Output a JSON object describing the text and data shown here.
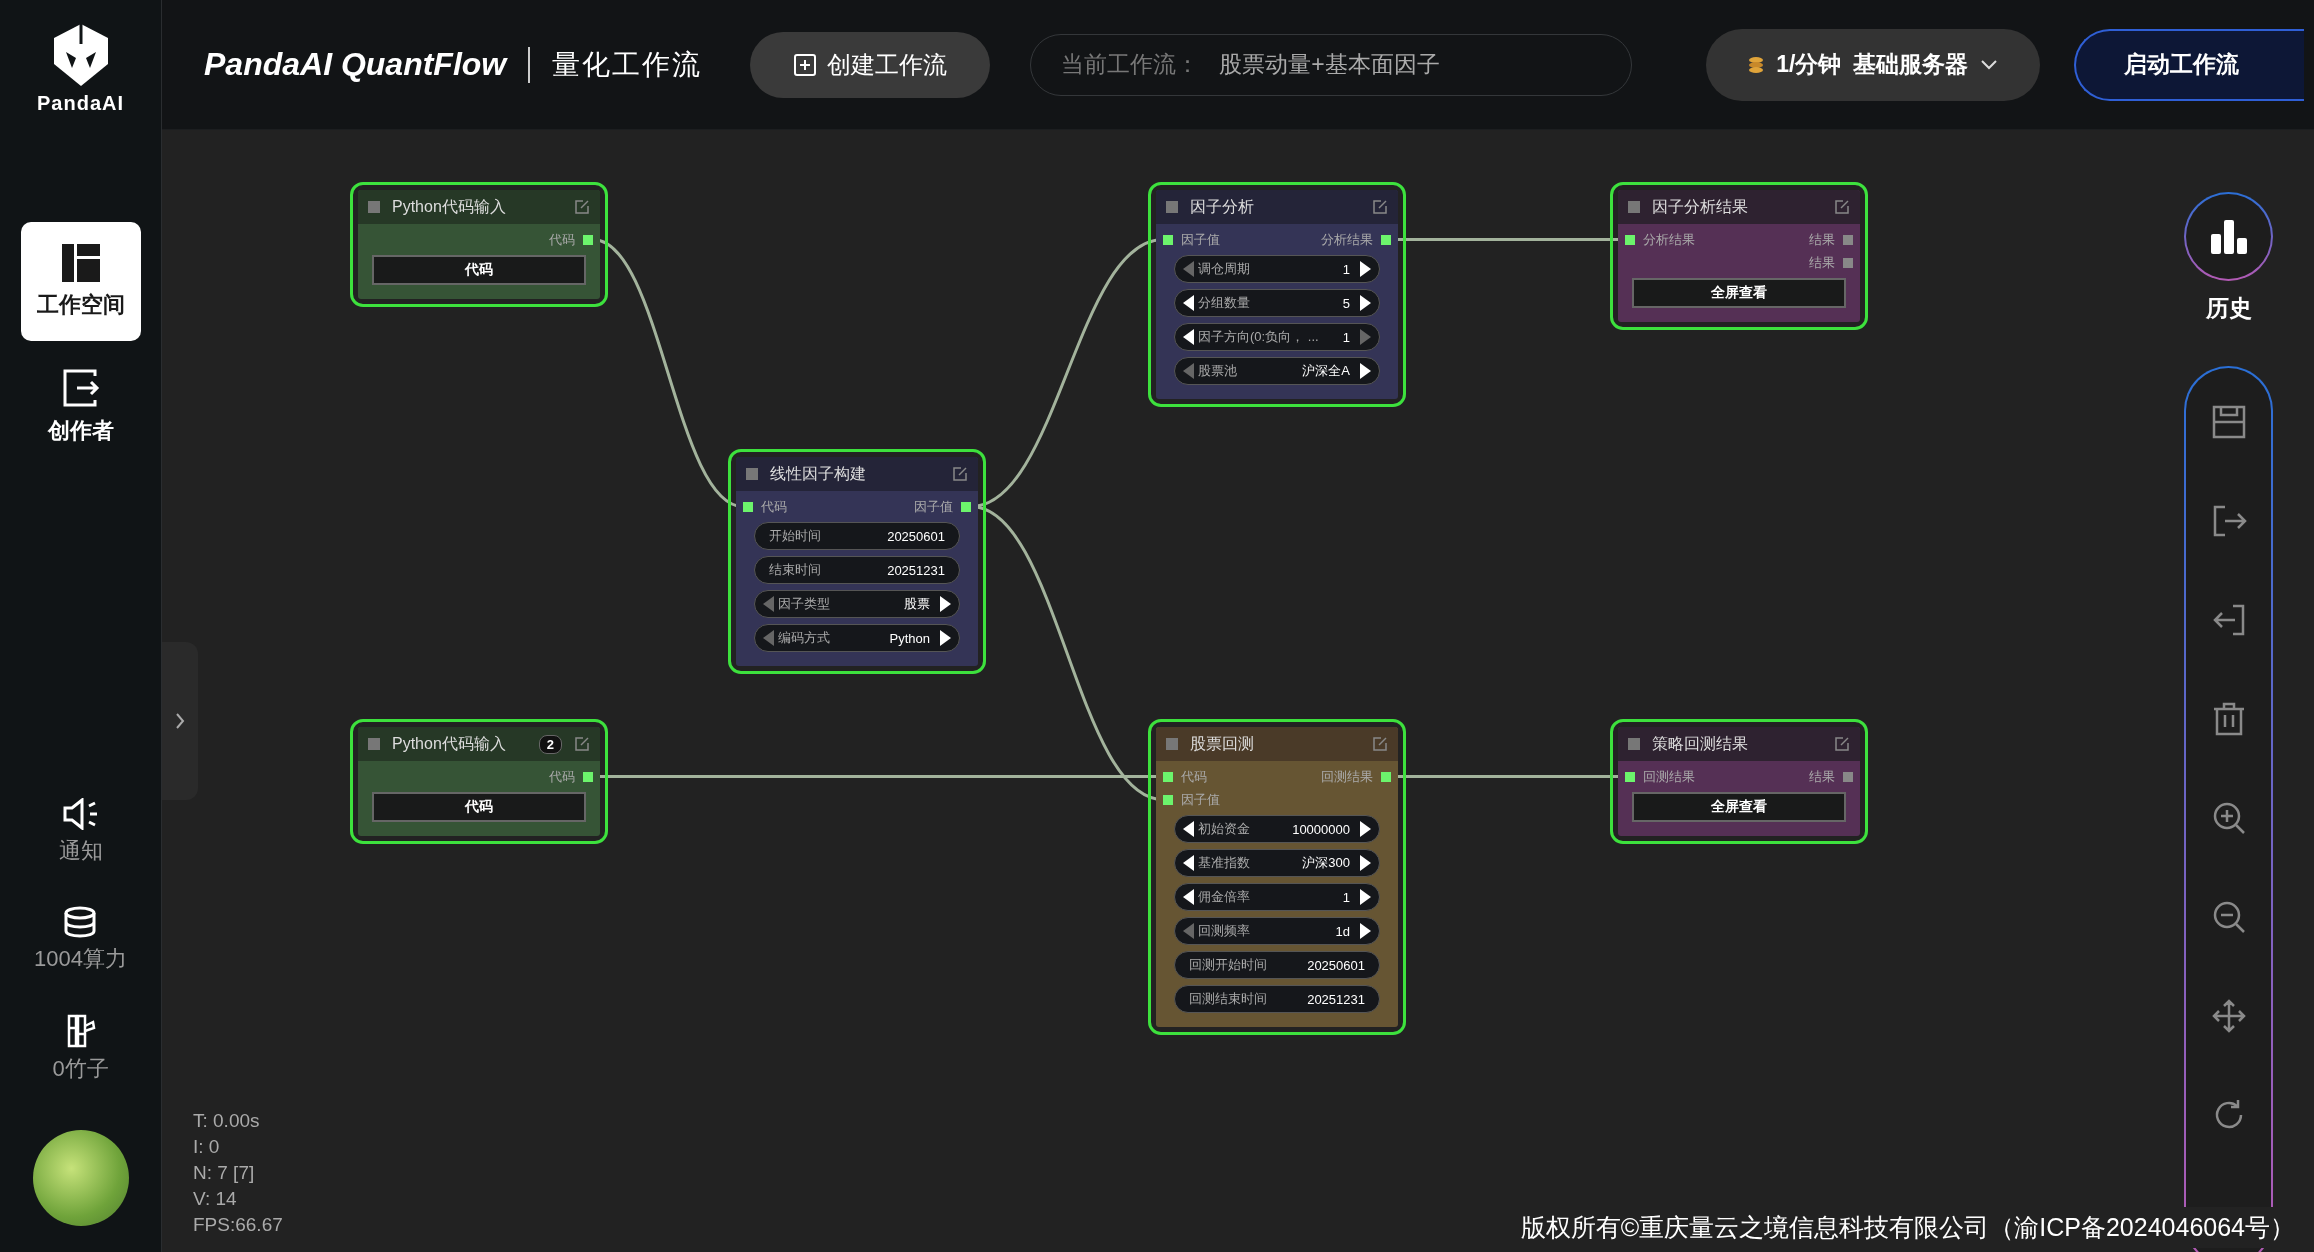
{
  "sidebar": {
    "logo_text": "PandaAI",
    "items": [
      {
        "label": "工作空间",
        "selected": true
      },
      {
        "label": "创作者",
        "selected": false
      }
    ],
    "bottom_items": [
      {
        "label": "通知"
      },
      {
        "label": "1004算力"
      },
      {
        "label": "0竹子"
      }
    ]
  },
  "header": {
    "title": "PandaAI QuantFlow",
    "subtitle": "量化工作流",
    "create_button": "创建工作流",
    "current_workflow": {
      "label": "当前工作流：",
      "value": "股票动量+基本面因子"
    },
    "plan": {
      "price": "1/分钟",
      "server": "基础服务器"
    },
    "start_button": "启动工作流"
  },
  "nodes": [
    {
      "kind": "input",
      "title": "Python代码输入",
      "outputs": [
        {
          "label": "代码",
          "connected": true
        }
      ],
      "widgets": [
        {
          "kind": "button",
          "label": "代码"
        }
      ]
    },
    {
      "kind": "analysis",
      "title": "线性因子构建",
      "inputs": [
        {
          "label": "代码",
          "connected": true
        }
      ],
      "outputs": [
        {
          "label": "因子值",
          "connected": true
        }
      ],
      "widgets": [
        {
          "kind": "field",
          "label": "开始时间",
          "value": "20250601"
        },
        {
          "kind": "field",
          "label": "结束时间",
          "value": "20251231"
        },
        {
          "kind": "combo",
          "label": "因子类型",
          "value": "股票",
          "prev_enabled": false,
          "next_enabled": true
        },
        {
          "kind": "combo",
          "label": "编码方式",
          "value": "Python",
          "prev_enabled": false,
          "next_enabled": true
        }
      ]
    },
    {
      "kind": "analysis",
      "title": "因子分析",
      "inputs": [
        {
          "label": "因子值",
          "connected": true
        }
      ],
      "outputs": [
        {
          "label": "分析结果",
          "connected": true
        }
      ],
      "widgets": [
        {
          "kind": "combo",
          "label": "调仓周期",
          "value": "1",
          "prev_enabled": false,
          "next_enabled": true
        },
        {
          "kind": "combo",
          "label": "分组数量",
          "value": "5",
          "prev_enabled": true,
          "next_enabled": true
        },
        {
          "kind": "combo",
          "label": "因子方向(0:负向，  ...",
          "value": "1",
          "prev_enabled": true,
          "next_enabled": false
        },
        {
          "kind": "combo",
          "label": "股票池",
          "value": "沪深全A",
          "prev_enabled": false,
          "next_enabled": true
        }
      ]
    },
    {
      "kind": "result",
      "title": "因子分析结果",
      "inputs": [
        {
          "label": "分析结果",
          "connected": true
        }
      ],
      "outputs": [
        {
          "label": "结果",
          "connected": false
        },
        {
          "label": "结果",
          "connected": false
        }
      ],
      "widgets": [
        {
          "kind": "button",
          "label": "全屏查看"
        }
      ]
    },
    {
      "kind": "input",
      "title": "Python代码输入",
      "badge": "2",
      "outputs": [
        {
          "label": "代码",
          "connected": true
        }
      ],
      "widgets": [
        {
          "kind": "button",
          "label": "代码"
        }
      ]
    },
    {
      "kind": "backtest",
      "title": "股票回测",
      "inputs": [
        {
          "label": "代码",
          "connected": true
        },
        {
          "label": "因子值",
          "connected": true
        }
      ],
      "outputs": [
        {
          "label": "回测结果",
          "connected": true
        }
      ],
      "widgets": [
        {
          "kind": "combo",
          "label": "初始资金",
          "value": "10000000",
          "prev_enabled": true,
          "next_enabled": true
        },
        {
          "kind": "combo",
          "label": "基准指数",
          "value": "沪深300",
          "prev_enabled": true,
          "next_enabled": true
        },
        {
          "kind": "combo",
          "label": "佣金倍率",
          "value": "1",
          "prev_enabled": true,
          "next_enabled": true
        },
        {
          "kind": "combo",
          "label": "回测频率",
          "value": "1d",
          "prev_enabled": false,
          "next_enabled": true
        },
        {
          "kind": "field",
          "label": "回测开始时间",
          "value": "20250601"
        },
        {
          "kind": "field",
          "label": "回测结束时间",
          "value": "20251231"
        }
      ]
    },
    {
      "kind": "result",
      "title": "策略回测结果",
      "inputs": [
        {
          "label": "回测结果",
          "connected": true
        }
      ],
      "outputs": [
        {
          "label": "结果",
          "connected": false
        }
      ],
      "widgets": [
        {
          "kind": "button",
          "label": "全屏查看"
        }
      ]
    }
  ],
  "stats": [
    "T: 0.00s",
    "I: 0",
    "N: 7 [7]",
    "V: 14",
    "FPS:66.67"
  ],
  "toolbar": {
    "history_label": "历史"
  },
  "footer": "版权所有©重庆量云之境信息科技有限公司（渝ICP备2024046064号）"
}
